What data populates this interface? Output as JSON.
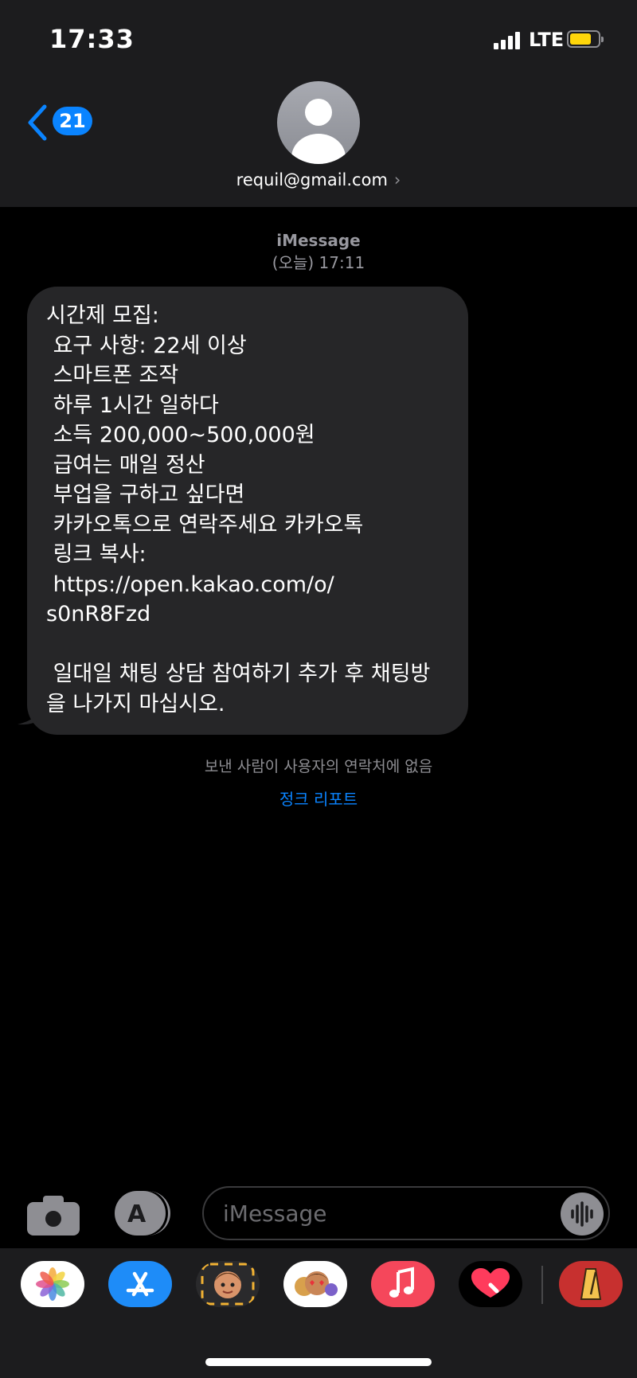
{
  "status_bar": {
    "time": "17:33",
    "carrier": "LTE"
  },
  "nav": {
    "back_badge": "21",
    "contact": "requil@gmail.com",
    "contact_arrow": "›"
  },
  "conversation": {
    "service": "iMessage",
    "timestamp": "(오늘) 17:11",
    "message": "시간제 모집:\n 요구 사항: 22세 이상\n 스마트폰 조작\n 하루 1시간 일하다\n 소득 200,000~500,000원\n 급여는 매일 정산\n 부업을 구하고 싶다면\n 카카오톡으로 연락주세요 카카오톡\n 링크 복사:\n https://open.kakao.com/o/\ns0nR8Fzd\n\n 일대일 채팅 상담 참여하기 추가 후 채팅방\n을 나가지 마십시오.",
    "unknown_sender_note": "보낸 사람이 사용자의 연락처에 없음",
    "report_junk": "정크 리포트"
  },
  "composer": {
    "placeholder": "iMessage",
    "apps_glyph": "A"
  },
  "app_tray": [
    {
      "name": "photos-app",
      "color": "#ffffff"
    },
    {
      "name": "app-store-app",
      "color": "#1e8cf8"
    },
    {
      "name": "memoji-app",
      "color": "#f2b233"
    },
    {
      "name": "memoji-stickers-app",
      "color": "#ffffff"
    },
    {
      "name": "music-app",
      "color": "#f5475b"
    },
    {
      "name": "digital-touch-app",
      "color": "#000000"
    },
    {
      "name": "metronome-app",
      "color": "#c7302f"
    }
  ],
  "colors": {
    "accent": "#0a84ff",
    "bubble": "#262628",
    "battery": "#ffd60a"
  }
}
